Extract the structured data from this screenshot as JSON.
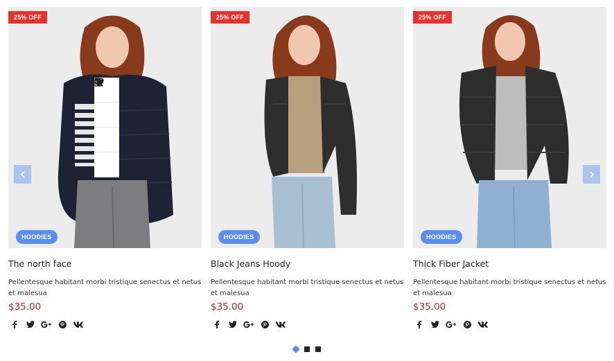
{
  "products": [
    {
      "sale_badge": "25% OFF",
      "category": "HOODIES",
      "title": "The north face",
      "description": "Pellentesque habitant morbi tristique senectus et netus et malesua",
      "price": "$35.00"
    },
    {
      "sale_badge": "25% OFF",
      "category": "HOODIES",
      "title": "Black Jeans Hoody",
      "description": "Pellentesque habitant morbi tristique senectus et netus et malesua",
      "price": "$35.00"
    },
    {
      "sale_badge": "25% OFF",
      "category": "HOODIES",
      "title": "Thick Fiber Jacket",
      "description": "Pellentesque habitant morbi tristique senectus et netus et malesua",
      "price": "$35.00"
    }
  ],
  "quick_actions": [
    "heart-icon",
    "search-icon",
    "cart-icon",
    "document-icon"
  ],
  "social_icons": [
    "facebook-icon",
    "twitter-icon",
    "google-plus-icon",
    "pinterest-icon",
    "vk-icon"
  ],
  "pagination": {
    "pages": 3,
    "active_index": 0
  },
  "colors": {
    "sale_badge": "#e5322d",
    "category_badge": "#5b8def",
    "price": "#b0282a",
    "nav_arrow": "#aac4ee",
    "active_dot": "#5b8def"
  }
}
